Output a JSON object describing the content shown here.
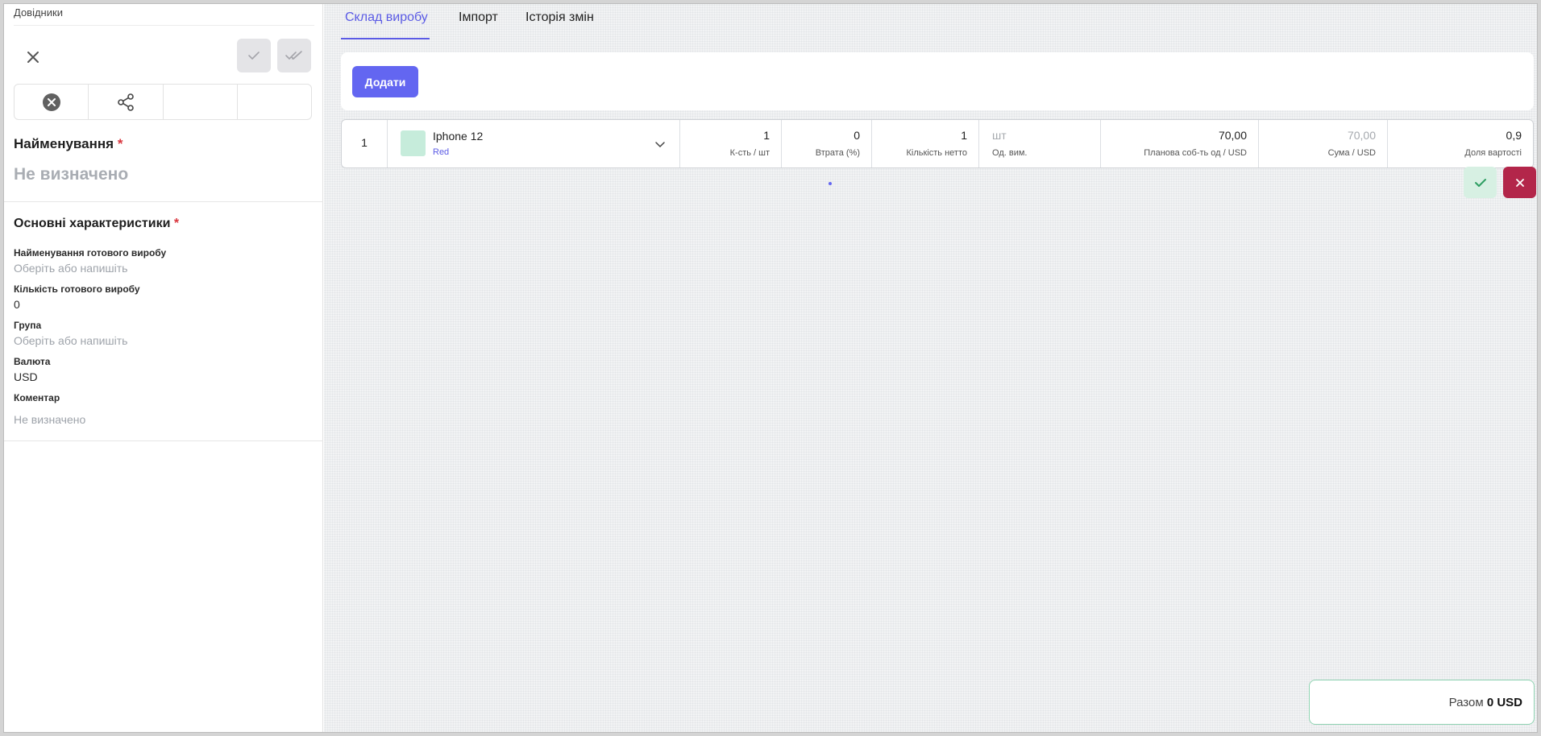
{
  "breadcrumb": "Довідники",
  "left": {
    "name_title": "Найменування",
    "required_mark": "*",
    "name_value": "Не визначено",
    "section_title": "Основні характеристики",
    "fields": [
      {
        "label": "Найменування готового виробу",
        "value": "Оберіть або напишіть",
        "placeholder": true
      },
      {
        "label": "Кількість готового виробу",
        "value": "0",
        "placeholder": false
      },
      {
        "label": "Група",
        "value": "Оберіть або напишіть",
        "placeholder": true
      },
      {
        "label": "Валюта",
        "value": "USD",
        "placeholder": false
      },
      {
        "label": "Коментар",
        "value": "Не визначено",
        "placeholder": true
      }
    ]
  },
  "tabs": [
    {
      "label": "Склад виробу",
      "active": true
    },
    {
      "label": "Імпорт",
      "active": false
    },
    {
      "label": "Історія змін",
      "active": false
    }
  ],
  "add_button": "Додати",
  "row": {
    "index": "1",
    "product_name": "Iphone 12",
    "variant": "Red",
    "quantity": {
      "value": "1",
      "label": "К-сть / шт"
    },
    "loss": {
      "value": "0",
      "label": "Втрата (%)"
    },
    "net_quantity": {
      "value": "1",
      "label": "Кількість нетто"
    },
    "unit": {
      "value": "шт",
      "label": "Од. вим."
    },
    "planned_cost": {
      "value": "70,00",
      "label": "Планова соб-ть од / USD"
    },
    "sum": {
      "value": "70,00",
      "label": "Сума / USD"
    },
    "cost_share": {
      "value": "0,9",
      "label": "Доля вартості"
    }
  },
  "total": {
    "label": "Разом",
    "value": "0 USD"
  },
  "colors": {
    "accent": "#6366f1",
    "danger": "#b3264a",
    "success_bg": "#d7f0e3"
  }
}
